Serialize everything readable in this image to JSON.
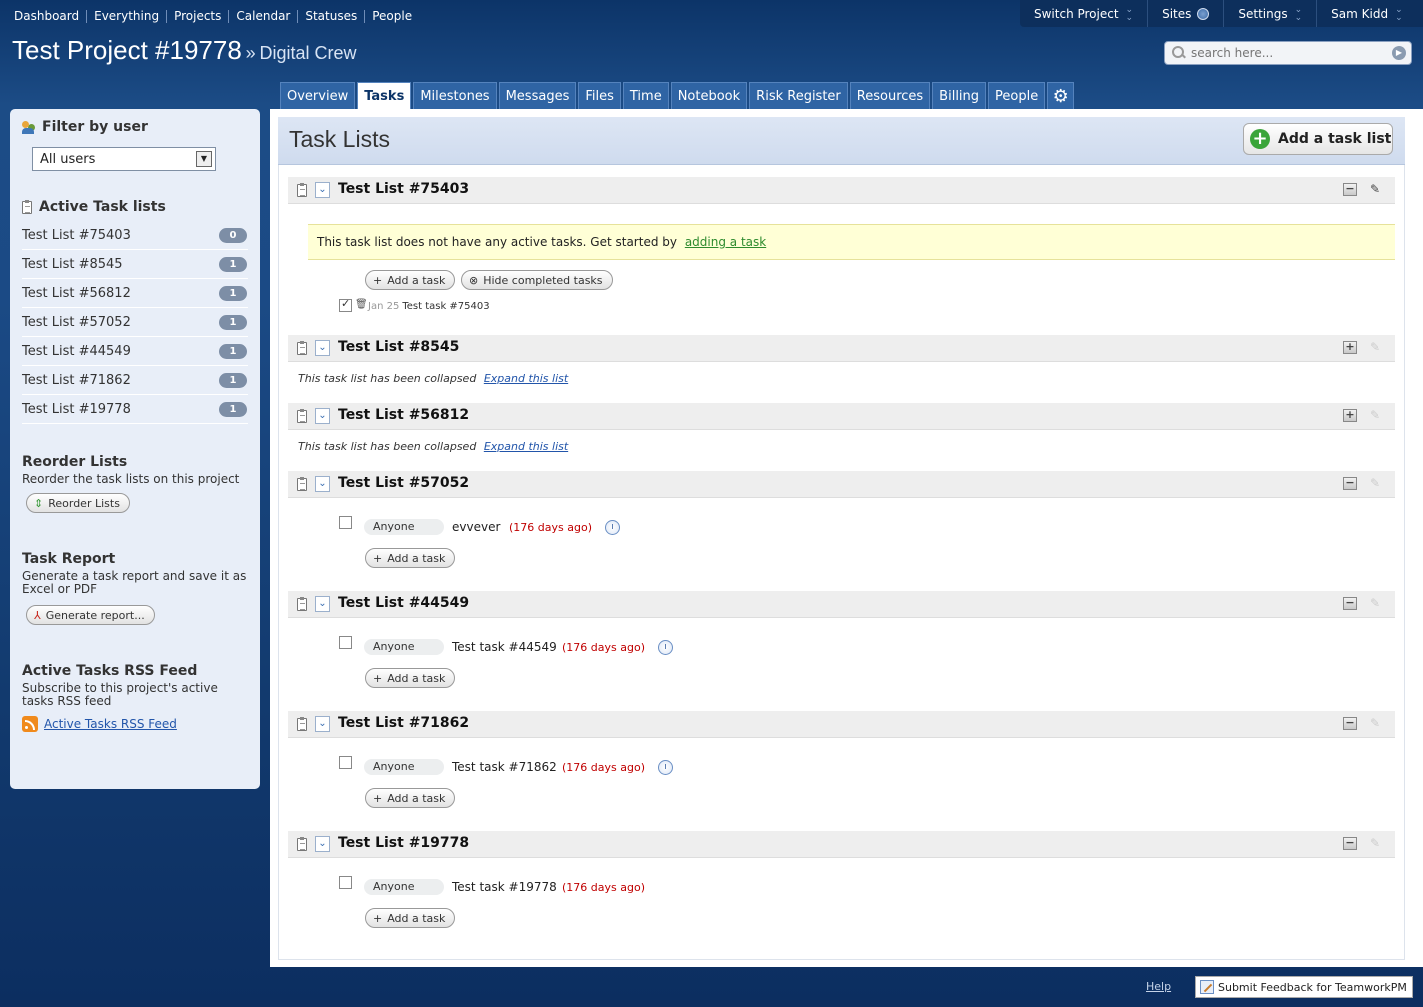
{
  "topnav": [
    "Dashboard",
    "Everything",
    "Projects",
    "Calendar",
    "Statuses",
    "People"
  ],
  "usermenu": {
    "switch_project": "Switch Project",
    "sites": "Sites",
    "settings": "Settings",
    "user": "Sam Kidd"
  },
  "project": {
    "name": "Test Project #19778",
    "company": "Digital Crew",
    "separator": "»"
  },
  "search": {
    "placeholder": "search here..."
  },
  "tabs": [
    "Overview",
    "Tasks",
    "Milestones",
    "Messages",
    "Files",
    "Time",
    "Notebook",
    "Risk Register",
    "Resources",
    "Billing",
    "People"
  ],
  "active_tab": "Tasks",
  "sidebar": {
    "filter_title": "Filter by user",
    "filter_value": "All users",
    "active_title": "Active Task lists",
    "lists": [
      {
        "name": "Test List #75403",
        "count": "0"
      },
      {
        "name": "Test List #8545",
        "count": "1"
      },
      {
        "name": "Test List #56812",
        "count": "1"
      },
      {
        "name": "Test List #57052",
        "count": "1"
      },
      {
        "name": "Test List #44549",
        "count": "1"
      },
      {
        "name": "Test List #71862",
        "count": "1"
      },
      {
        "name": "Test List #19778",
        "count": "1"
      }
    ],
    "reorder_title": "Reorder Lists",
    "reorder_desc": "Reorder the task lists on this project",
    "reorder_btn": "Reorder Lists",
    "report_title": "Task Report",
    "report_desc": "Generate a task report and save it as Excel or PDF",
    "report_btn": "Generate report...",
    "rss_title": "Active Tasks RSS Feed",
    "rss_desc": "Subscribe to this project's active tasks RSS feed",
    "rss_link": "Active Tasks RSS Feed"
  },
  "main": {
    "title": "Task Lists",
    "add_list": "Add a task list",
    "empty_notice": "This task list does not have any active tasks. Get started by",
    "empty_link": "adding a task",
    "add_task": "Add a task",
    "hide_completed": "Hide completed tasks",
    "collapsed_text": "This task list has been collapsed",
    "expand_link": "Expand this list",
    "anyone": "Anyone",
    "completed_task": {
      "date": "Jan 25",
      "name": "Test task #75403"
    },
    "lists": [
      {
        "name": "Test List #75403"
      },
      {
        "name": "Test List #8545"
      },
      {
        "name": "Test List #56812"
      },
      {
        "name": "Test List #57052",
        "task": "evvever",
        "age": "(176 days ago)"
      },
      {
        "name": "Test List #44549",
        "task": "Test task #44549",
        "age": "(176 days ago)"
      },
      {
        "name": "Test List #71862",
        "task": "Test task #71862",
        "age": "(176 days ago)"
      },
      {
        "name": "Test List #19778",
        "task": "Test task #19778",
        "age": "(176 days ago)"
      }
    ]
  },
  "footer": {
    "help": "Help",
    "feedback": "Submit Feedback for TeamworkPM"
  }
}
